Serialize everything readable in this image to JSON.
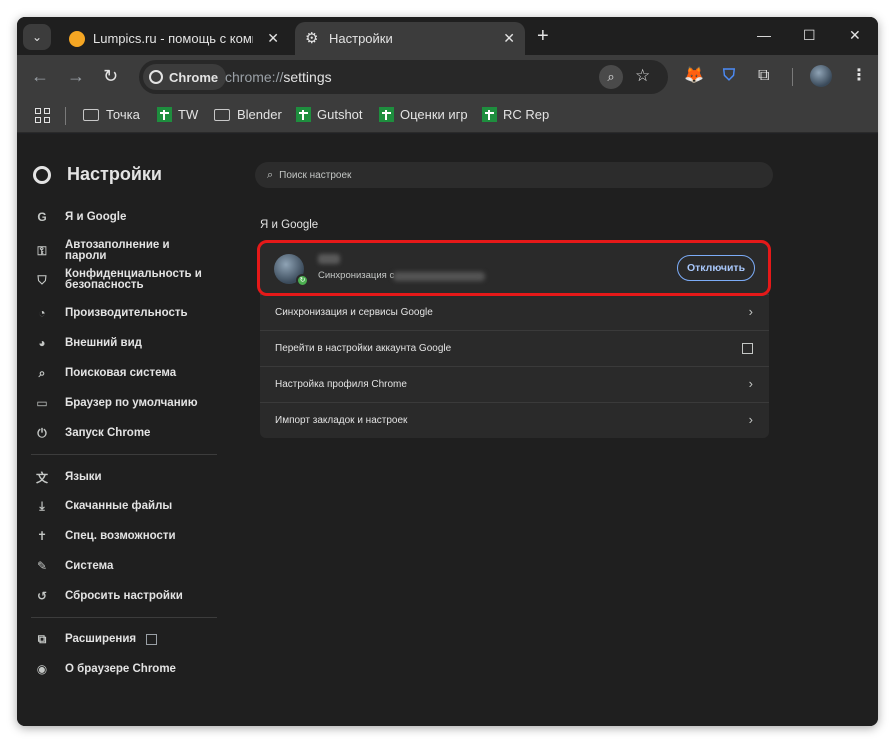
{
  "tabs": [
    {
      "title": "Lumpics.ru - помощь с компью",
      "favicon_color": "#f5a623"
    },
    {
      "title": "Настройки",
      "favicon": "gear-icon"
    }
  ],
  "window_controls": {
    "minimize": "—",
    "maximize": "☐",
    "close": "✕"
  },
  "toolbar": {
    "chip_label": "Chrome",
    "url_scheme": "chrome://",
    "url_path": "settings"
  },
  "bookmarks": [
    {
      "label": "Точка",
      "icon": "folder-icon"
    },
    {
      "label": "TW",
      "icon": "sheets-icon"
    },
    {
      "label": "Blender",
      "icon": "folder-icon"
    },
    {
      "label": "Gutshot",
      "icon": "sheets-icon"
    },
    {
      "label": "Оценки игр",
      "icon": "sheets-icon"
    },
    {
      "label": "RC Rep",
      "icon": "sheets-icon"
    }
  ],
  "sidebar": {
    "title": "Настройки",
    "items": [
      {
        "label": "Я и Google",
        "icon": "google-icon"
      },
      {
        "label": "Автозаполнение и пароли",
        "icon": "key-icon"
      },
      {
        "label": "Конфиденциальность и безопасность",
        "icon": "shield-icon"
      },
      {
        "label": "Производительность",
        "icon": "speedometer-icon"
      },
      {
        "label": "Внешний вид",
        "icon": "palette-icon"
      },
      {
        "label": "Поисковая система",
        "icon": "search-icon"
      },
      {
        "label": "Браузер по умолчанию",
        "icon": "browser-icon"
      },
      {
        "label": "Запуск Chrome",
        "icon": "power-icon"
      },
      {
        "label": "Языки",
        "icon": "translate-icon"
      },
      {
        "label": "Скачанные файлы",
        "icon": "download-icon"
      },
      {
        "label": "Спец. возможности",
        "icon": "accessibility-icon"
      },
      {
        "label": "Система",
        "icon": "wrench-icon"
      },
      {
        "label": "Сбросить настройки",
        "icon": "reset-icon"
      },
      {
        "label": "Расширения",
        "icon": "puzzle-icon"
      },
      {
        "label": "О браузере Chrome",
        "icon": "chrome-icon"
      }
    ]
  },
  "search": {
    "placeholder": "Поиск настроек"
  },
  "main": {
    "section_title": "Я и Google",
    "profile": {
      "sync_text": "Синхронизация с",
      "disconnect_label": "Отключить"
    },
    "rows": [
      {
        "label": "Синхронизация и сервисы Google",
        "action": "chevron-right-icon"
      },
      {
        "label": "Перейти в настройки аккаунта Google",
        "action": "external-link-icon"
      },
      {
        "label": "Настройка профиля Chrome",
        "action": "chevron-right-icon"
      },
      {
        "label": "Импорт закладок и настроек",
        "action": "chevron-right-icon"
      }
    ]
  },
  "colors": {
    "highlight": "#e51919",
    "button_accent": "#a8c7fa"
  }
}
